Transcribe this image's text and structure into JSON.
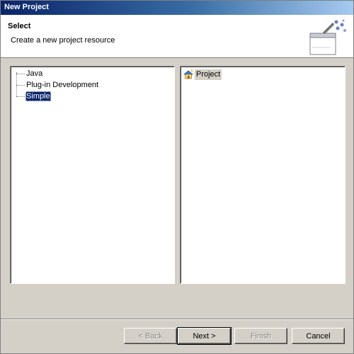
{
  "window": {
    "title": "New Project"
  },
  "header": {
    "title": "Select",
    "description": "Create a new project resource"
  },
  "categories": [
    {
      "label": "Java",
      "selected": false
    },
    {
      "label": "Plug-in Development",
      "selected": false
    },
    {
      "label": "Simple",
      "selected": true
    }
  ],
  "wizards": [
    {
      "label": "Project",
      "icon": "project-icon"
    }
  ],
  "buttons": {
    "back": "< Back",
    "next": "Next >",
    "finish": "Finish",
    "cancel": "Cancel"
  },
  "icons": {
    "header": "new-wizard-icon"
  },
  "colors": {
    "title_bar": "#0a246a",
    "selection": "#0a246a",
    "dialog_face": "#d4d0c8"
  }
}
